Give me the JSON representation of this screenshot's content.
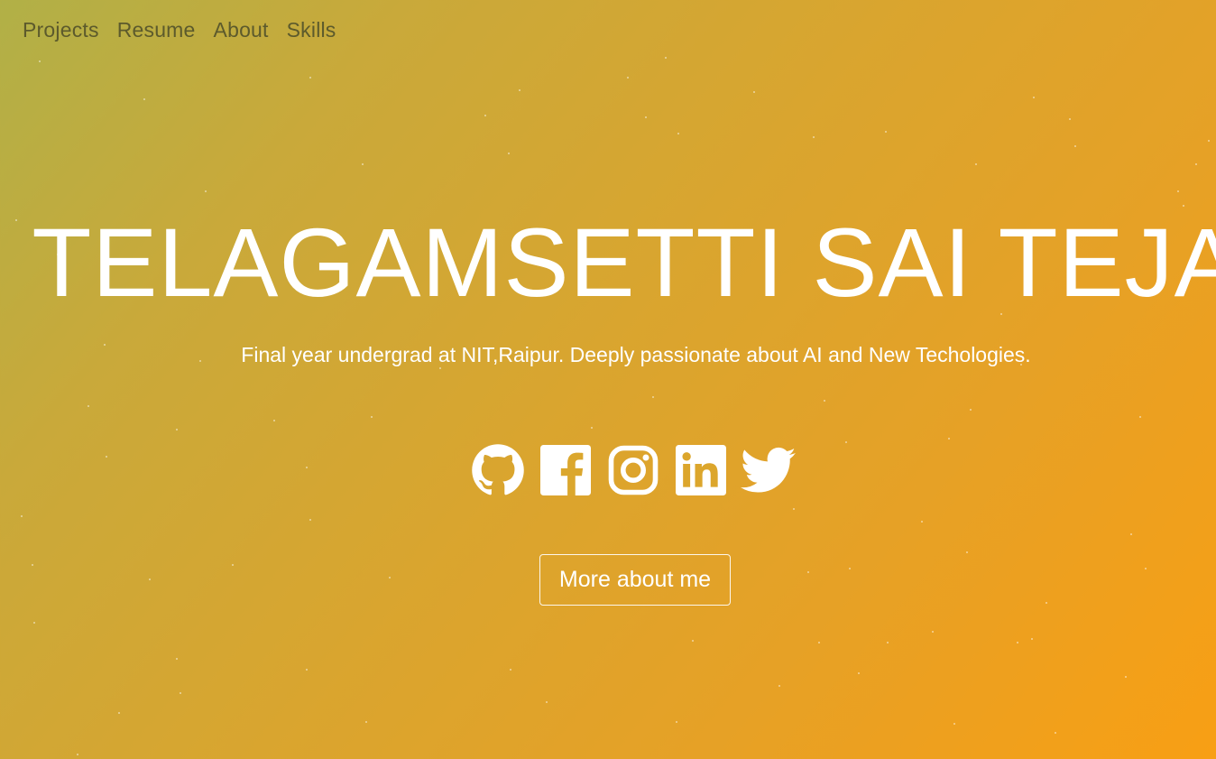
{
  "nav": {
    "items": [
      {
        "label": "Projects"
      },
      {
        "label": "Resume"
      },
      {
        "label": "About"
      },
      {
        "label": "Skills"
      }
    ]
  },
  "hero": {
    "title": "TELAGAMSETTI SAI TEJA",
    "subtitle": "Final year undergrad at NIT,Raipur. Deeply passionate about AI and New Techologies.",
    "cta_label": "More about me"
  },
  "socials": [
    {
      "icon": "github-icon"
    },
    {
      "icon": "facebook-icon"
    },
    {
      "icon": "instagram-icon"
    },
    {
      "icon": "linkedin-icon"
    },
    {
      "icon": "twitter-icon"
    }
  ],
  "colors": {
    "gradient_start": "#b1b047",
    "gradient_end": "#f89f14",
    "text": "#ffffff",
    "nav_text": "#5c5a2c"
  }
}
